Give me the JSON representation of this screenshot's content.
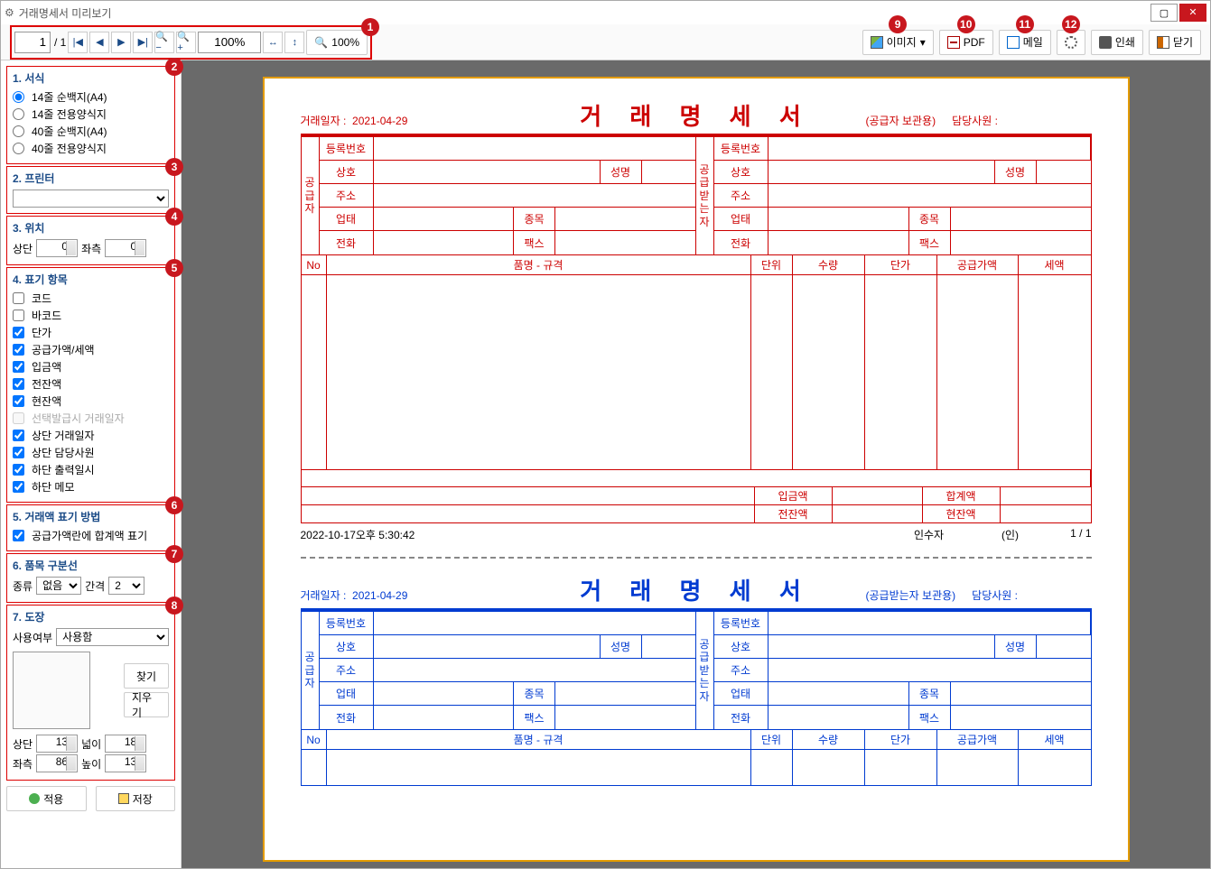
{
  "window": {
    "title": "거래명세서 미리보기"
  },
  "toolbar": {
    "page_current": "1",
    "page_total": "/ 1",
    "zoom_value": "100%",
    "zoom_fit": "100%",
    "image": "이미지",
    "pdf": "PDF",
    "mail": "메일",
    "print": "인쇄",
    "close": "닫기"
  },
  "markers": [
    "1",
    "2",
    "3",
    "4",
    "5",
    "6",
    "7",
    "8",
    "9",
    "10",
    "11",
    "12"
  ],
  "s1": {
    "title": "1. 서식",
    "opts": [
      "14줄 순백지(A4)",
      "14줄 전용양식지",
      "40줄 순백지(A4)",
      "40줄 전용양식지"
    ]
  },
  "s2": {
    "title": "2. 프린터"
  },
  "s3": {
    "title": "3. 위치",
    "top": "상단",
    "topv": "0",
    "left": "좌측",
    "leftv": "0"
  },
  "s4": {
    "title": "4. 표기 항목",
    "items": [
      {
        "l": "코드",
        "c": false
      },
      {
        "l": "바코드",
        "c": false
      },
      {
        "l": "단가",
        "c": true
      },
      {
        "l": "공급가액/세액",
        "c": true
      },
      {
        "l": "입금액",
        "c": true
      },
      {
        "l": "전잔액",
        "c": true
      },
      {
        "l": "현잔액",
        "c": true
      },
      {
        "l": "선택발급시 거래일자",
        "c": false,
        "d": true
      },
      {
        "l": "상단 거래일자",
        "c": true
      },
      {
        "l": "상단 담당사원",
        "c": true
      },
      {
        "l": "하단 출력일시",
        "c": true
      },
      {
        "l": "하단 메모",
        "c": true
      }
    ]
  },
  "s5": {
    "title": "5. 거래액 표기 방법",
    "opt": "공급가액란에 합계액 표기"
  },
  "s6": {
    "title": "6. 품목 구분선",
    "kind": "종류",
    "kindv": "없음",
    "gap": "간격",
    "gapv": "2"
  },
  "s7": {
    "title": "7. 도장",
    "use": "사용여부",
    "usev": "사용함",
    "find": "찾기",
    "clear": "지우기",
    "top": "상단",
    "topv": "13",
    "width": "넓이",
    "widthv": "18",
    "left": "좌측",
    "leftv": "86",
    "height": "높이",
    "heightv": "13"
  },
  "btm": {
    "apply": "적용",
    "save": "저장"
  },
  "invoice": {
    "title": "거 래 명 세 서",
    "date_lab": "거래일자 :",
    "date": "2021-04-29",
    "keep_red": "(공급자 보관용)",
    "keep_blue": "(공급받는자 보관용)",
    "staff": "담당사원 :",
    "supplier": "공급자",
    "receiver": "공급받는자",
    "reg": "등록번호",
    "company": "상호",
    "name": "성명",
    "addr": "주소",
    "biz": "업태",
    "item": "종목",
    "tel": "전화",
    "fax": "팩스",
    "cols": [
      "No",
      "품명 - 규격",
      "단위",
      "수량",
      "단가",
      "공급가액",
      "세액"
    ],
    "deposit": "입금액",
    "total": "합계액",
    "prev": "전잔액",
    "curr": "현잔액",
    "printed": "2022-10-17오후 5:30:42",
    "rcv": "인수자",
    "stamp": "(인)",
    "pg": "1 / 1"
  }
}
